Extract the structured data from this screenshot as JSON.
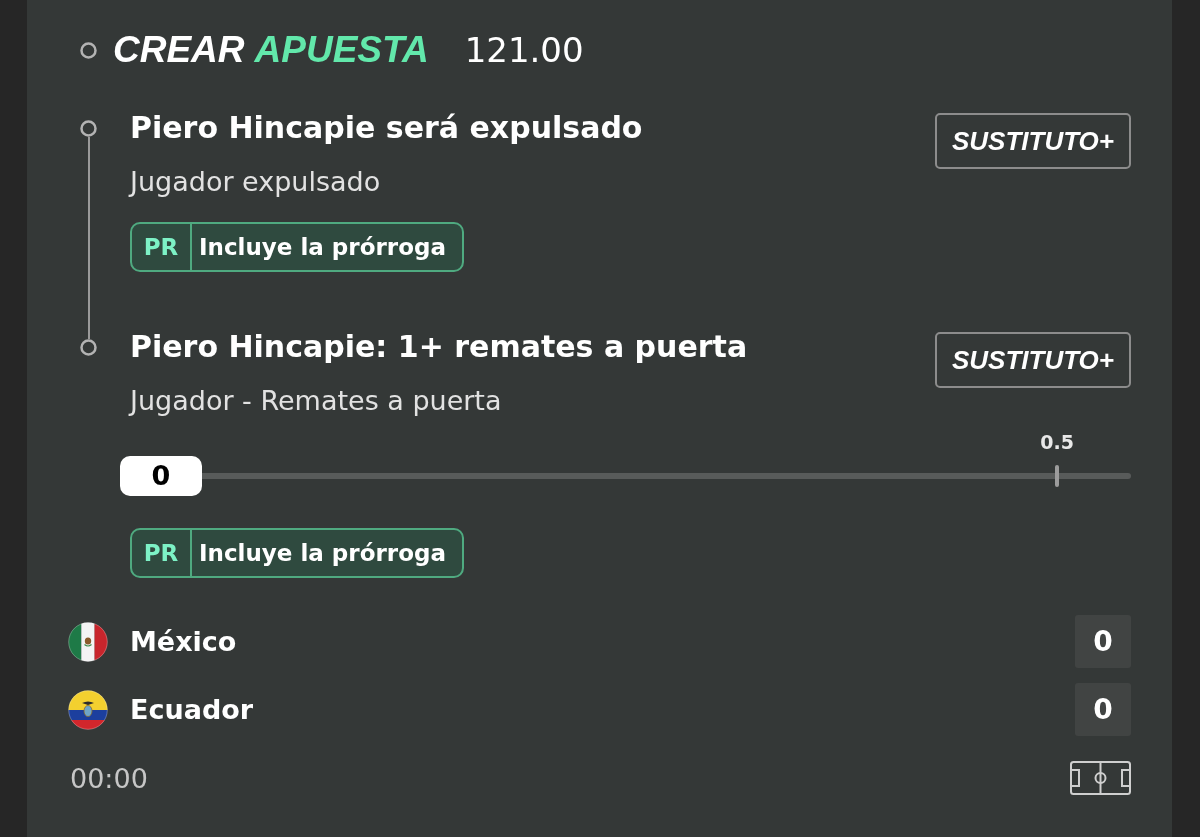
{
  "header": {
    "title": "CREAR",
    "title_accent": "APUESTA",
    "odds": "121.00"
  },
  "selections": [
    {
      "title": "Piero Hincapie será expulsado",
      "market": "Jugador expulsado",
      "button": "SUSTITUTO+",
      "badge": {
        "code": "PR",
        "label": "Incluye la prórroga"
      }
    },
    {
      "title": "Piero Hincapie: 1+ remates a puerta",
      "market": "Jugador - Remates a puerta",
      "button": "SUSTITUTO+",
      "slider": {
        "value": "0",
        "level": 0,
        "tick_label": "0.5"
      },
      "badge": {
        "code": "PR",
        "label": "Incluye la prórroga"
      }
    }
  ],
  "match": {
    "teams": [
      {
        "name": "México",
        "kind": "mexico",
        "score": "0"
      },
      {
        "name": "Ecuador",
        "kind": "ecuador",
        "score": "0"
      }
    ],
    "time": "00:00"
  }
}
